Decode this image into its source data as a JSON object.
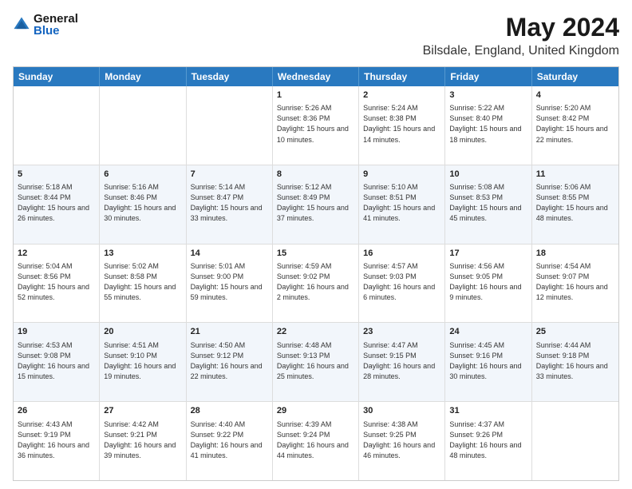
{
  "logo": {
    "general": "General",
    "blue": "Blue"
  },
  "header": {
    "title": "May 2024",
    "subtitle": "Bilsdale, England, United Kingdom"
  },
  "weekdays": [
    "Sunday",
    "Monday",
    "Tuesday",
    "Wednesday",
    "Thursday",
    "Friday",
    "Saturday"
  ],
  "weeks": [
    [
      {
        "day": "",
        "sunrise": "",
        "sunset": "",
        "daylight": ""
      },
      {
        "day": "",
        "sunrise": "",
        "sunset": "",
        "daylight": ""
      },
      {
        "day": "",
        "sunrise": "",
        "sunset": "",
        "daylight": ""
      },
      {
        "day": "1",
        "sunrise": "Sunrise: 5:26 AM",
        "sunset": "Sunset: 8:36 PM",
        "daylight": "Daylight: 15 hours and 10 minutes."
      },
      {
        "day": "2",
        "sunrise": "Sunrise: 5:24 AM",
        "sunset": "Sunset: 8:38 PM",
        "daylight": "Daylight: 15 hours and 14 minutes."
      },
      {
        "day": "3",
        "sunrise": "Sunrise: 5:22 AM",
        "sunset": "Sunset: 8:40 PM",
        "daylight": "Daylight: 15 hours and 18 minutes."
      },
      {
        "day": "4",
        "sunrise": "Sunrise: 5:20 AM",
        "sunset": "Sunset: 8:42 PM",
        "daylight": "Daylight: 15 hours and 22 minutes."
      }
    ],
    [
      {
        "day": "5",
        "sunrise": "Sunrise: 5:18 AM",
        "sunset": "Sunset: 8:44 PM",
        "daylight": "Daylight: 15 hours and 26 minutes."
      },
      {
        "day": "6",
        "sunrise": "Sunrise: 5:16 AM",
        "sunset": "Sunset: 8:46 PM",
        "daylight": "Daylight: 15 hours and 30 minutes."
      },
      {
        "day": "7",
        "sunrise": "Sunrise: 5:14 AM",
        "sunset": "Sunset: 8:47 PM",
        "daylight": "Daylight: 15 hours and 33 minutes."
      },
      {
        "day": "8",
        "sunrise": "Sunrise: 5:12 AM",
        "sunset": "Sunset: 8:49 PM",
        "daylight": "Daylight: 15 hours and 37 minutes."
      },
      {
        "day": "9",
        "sunrise": "Sunrise: 5:10 AM",
        "sunset": "Sunset: 8:51 PM",
        "daylight": "Daylight: 15 hours and 41 minutes."
      },
      {
        "day": "10",
        "sunrise": "Sunrise: 5:08 AM",
        "sunset": "Sunset: 8:53 PM",
        "daylight": "Daylight: 15 hours and 45 minutes."
      },
      {
        "day": "11",
        "sunrise": "Sunrise: 5:06 AM",
        "sunset": "Sunset: 8:55 PM",
        "daylight": "Daylight: 15 hours and 48 minutes."
      }
    ],
    [
      {
        "day": "12",
        "sunrise": "Sunrise: 5:04 AM",
        "sunset": "Sunset: 8:56 PM",
        "daylight": "Daylight: 15 hours and 52 minutes."
      },
      {
        "day": "13",
        "sunrise": "Sunrise: 5:02 AM",
        "sunset": "Sunset: 8:58 PM",
        "daylight": "Daylight: 15 hours and 55 minutes."
      },
      {
        "day": "14",
        "sunrise": "Sunrise: 5:01 AM",
        "sunset": "Sunset: 9:00 PM",
        "daylight": "Daylight: 15 hours and 59 minutes."
      },
      {
        "day": "15",
        "sunrise": "Sunrise: 4:59 AM",
        "sunset": "Sunset: 9:02 PM",
        "daylight": "Daylight: 16 hours and 2 minutes."
      },
      {
        "day": "16",
        "sunrise": "Sunrise: 4:57 AM",
        "sunset": "Sunset: 9:03 PM",
        "daylight": "Daylight: 16 hours and 6 minutes."
      },
      {
        "day": "17",
        "sunrise": "Sunrise: 4:56 AM",
        "sunset": "Sunset: 9:05 PM",
        "daylight": "Daylight: 16 hours and 9 minutes."
      },
      {
        "day": "18",
        "sunrise": "Sunrise: 4:54 AM",
        "sunset": "Sunset: 9:07 PM",
        "daylight": "Daylight: 16 hours and 12 minutes."
      }
    ],
    [
      {
        "day": "19",
        "sunrise": "Sunrise: 4:53 AM",
        "sunset": "Sunset: 9:08 PM",
        "daylight": "Daylight: 16 hours and 15 minutes."
      },
      {
        "day": "20",
        "sunrise": "Sunrise: 4:51 AM",
        "sunset": "Sunset: 9:10 PM",
        "daylight": "Daylight: 16 hours and 19 minutes."
      },
      {
        "day": "21",
        "sunrise": "Sunrise: 4:50 AM",
        "sunset": "Sunset: 9:12 PM",
        "daylight": "Daylight: 16 hours and 22 minutes."
      },
      {
        "day": "22",
        "sunrise": "Sunrise: 4:48 AM",
        "sunset": "Sunset: 9:13 PM",
        "daylight": "Daylight: 16 hours and 25 minutes."
      },
      {
        "day": "23",
        "sunrise": "Sunrise: 4:47 AM",
        "sunset": "Sunset: 9:15 PM",
        "daylight": "Daylight: 16 hours and 28 minutes."
      },
      {
        "day": "24",
        "sunrise": "Sunrise: 4:45 AM",
        "sunset": "Sunset: 9:16 PM",
        "daylight": "Daylight: 16 hours and 30 minutes."
      },
      {
        "day": "25",
        "sunrise": "Sunrise: 4:44 AM",
        "sunset": "Sunset: 9:18 PM",
        "daylight": "Daylight: 16 hours and 33 minutes."
      }
    ],
    [
      {
        "day": "26",
        "sunrise": "Sunrise: 4:43 AM",
        "sunset": "Sunset: 9:19 PM",
        "daylight": "Daylight: 16 hours and 36 minutes."
      },
      {
        "day": "27",
        "sunrise": "Sunrise: 4:42 AM",
        "sunset": "Sunset: 9:21 PM",
        "daylight": "Daylight: 16 hours and 39 minutes."
      },
      {
        "day": "28",
        "sunrise": "Sunrise: 4:40 AM",
        "sunset": "Sunset: 9:22 PM",
        "daylight": "Daylight: 16 hours and 41 minutes."
      },
      {
        "day": "29",
        "sunrise": "Sunrise: 4:39 AM",
        "sunset": "Sunset: 9:24 PM",
        "daylight": "Daylight: 16 hours and 44 minutes."
      },
      {
        "day": "30",
        "sunrise": "Sunrise: 4:38 AM",
        "sunset": "Sunset: 9:25 PM",
        "daylight": "Daylight: 16 hours and 46 minutes."
      },
      {
        "day": "31",
        "sunrise": "Sunrise: 4:37 AM",
        "sunset": "Sunset: 9:26 PM",
        "daylight": "Daylight: 16 hours and 48 minutes."
      },
      {
        "day": "",
        "sunrise": "",
        "sunset": "",
        "daylight": ""
      }
    ]
  ]
}
